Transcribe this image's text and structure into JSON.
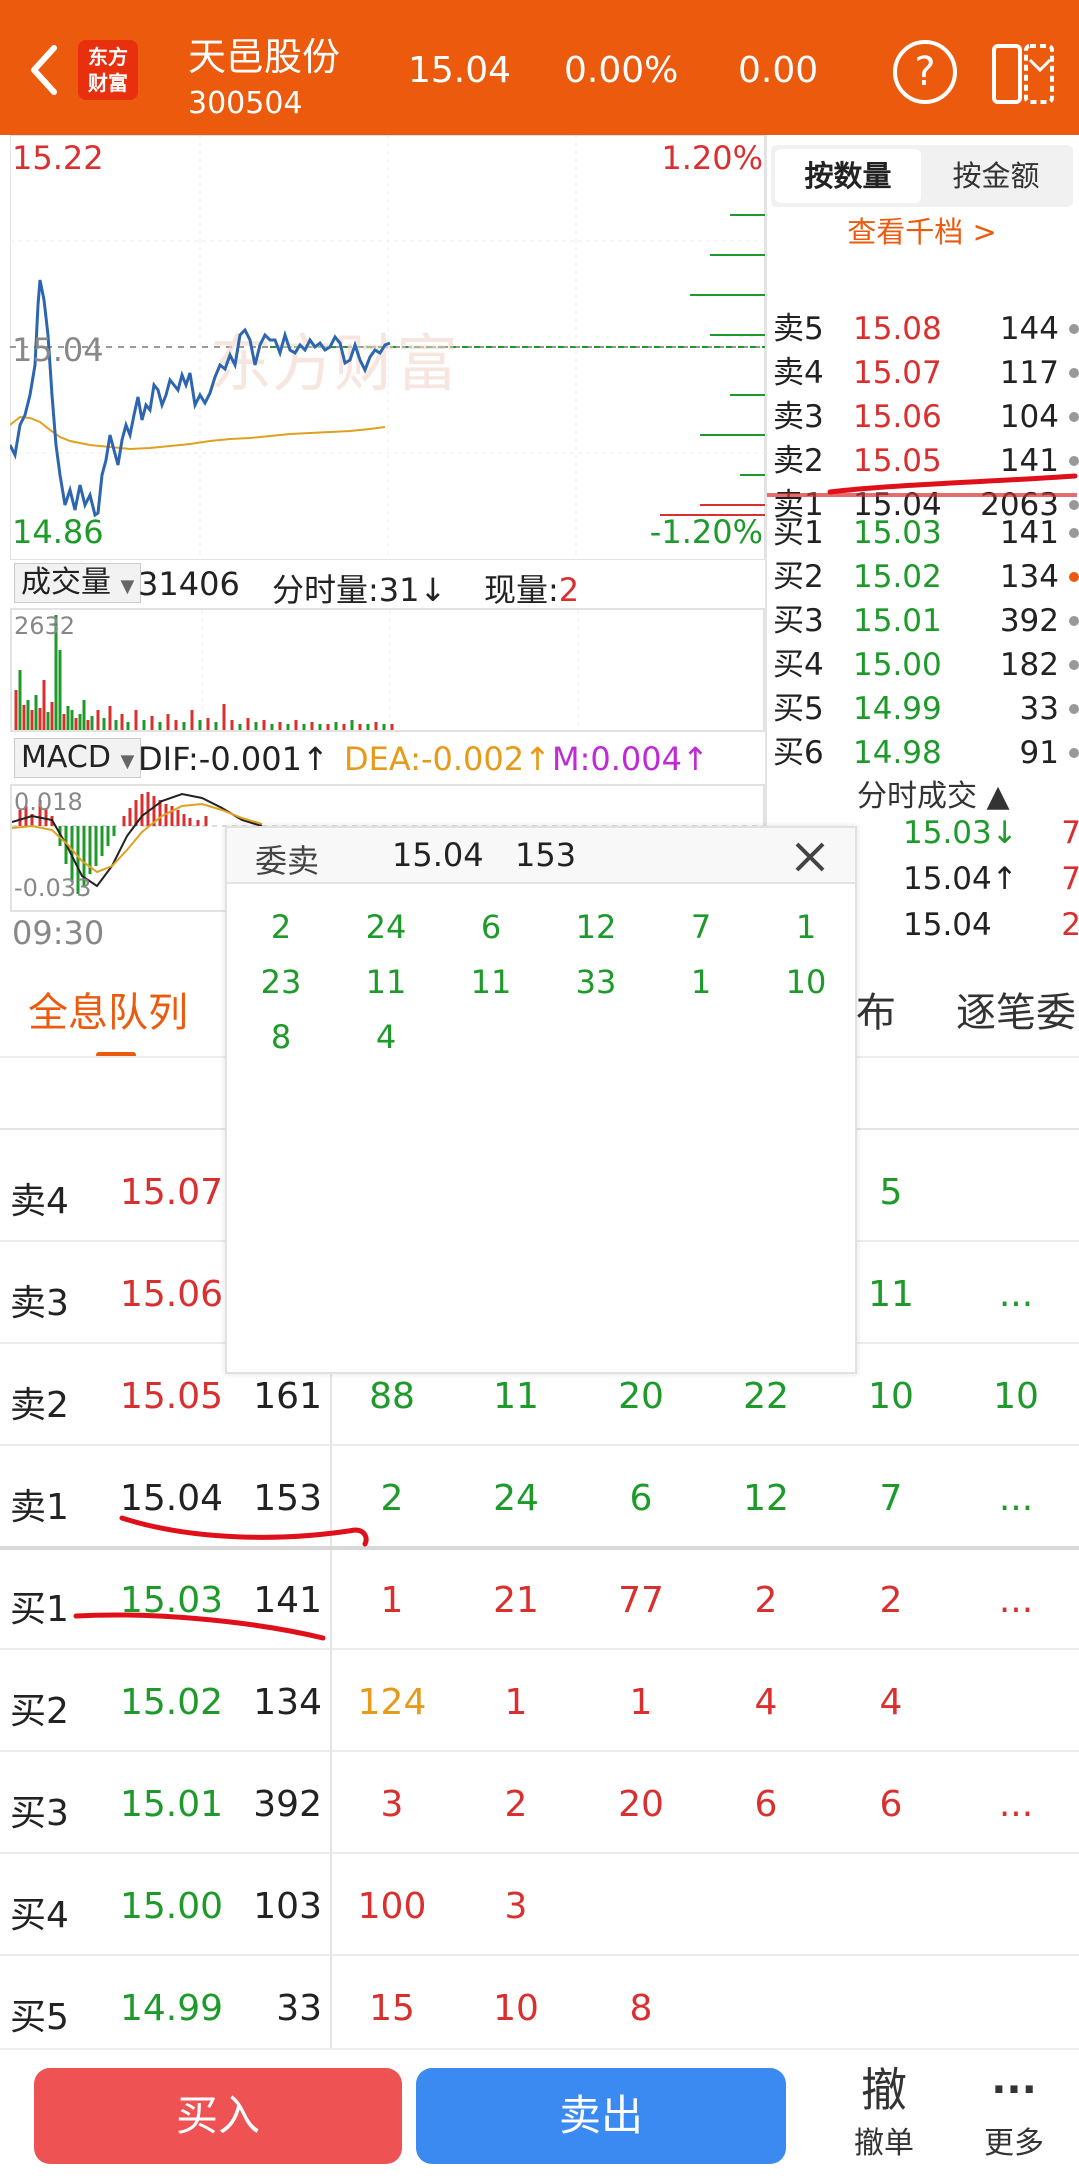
{
  "header": {
    "logo_text": "东方财富",
    "stock_name": "天邑股份",
    "stock_code": "300504",
    "price": "15.04",
    "change_pct": "0.00%",
    "change": "0.00",
    "help_glyph": "?"
  },
  "chart": {
    "price_high": "15.22",
    "price_mid": "15.04",
    "price_low": "14.86",
    "pct_high": "1.20%",
    "pct_low": "-1.20%",
    "watermark": "东方财富",
    "time_start": "09:30"
  },
  "volume": {
    "selector": "成交量",
    "total": "31406",
    "minute_label": "分时量:",
    "minute_value": "31",
    "current_label": "现量:",
    "current_value": "2",
    "max_label": "2632"
  },
  "macd": {
    "selector": "MACD",
    "dif": "DIF:-0.001",
    "dea": "DEA:-0.002",
    "m": "M:0.004",
    "top_label": "0.018",
    "bottom_label": "-0.033"
  },
  "order_book": {
    "tab_qty": "按数量",
    "tab_amount": "按金额",
    "view_more": "查看千档 >",
    "asks": [
      {
        "label": "卖5",
        "price": "15.08",
        "vol": "144"
      },
      {
        "label": "卖4",
        "price": "15.07",
        "vol": "117"
      },
      {
        "label": "卖3",
        "price": "15.06",
        "vol": "104"
      },
      {
        "label": "卖2",
        "price": "15.05",
        "vol": "141"
      },
      {
        "label": "卖1",
        "price": "15.04",
        "vol": "2063"
      }
    ],
    "bids": [
      {
        "label": "买1",
        "price": "15.03",
        "vol": "141"
      },
      {
        "label": "买2",
        "price": "15.02",
        "vol": "134"
      },
      {
        "label": "买3",
        "price": "15.01",
        "vol": "392"
      },
      {
        "label": "买4",
        "price": "15.00",
        "vol": "182"
      },
      {
        "label": "买5",
        "price": "14.99",
        "vol": "33"
      },
      {
        "label": "买6",
        "price": "14.98",
        "vol": "91"
      }
    ],
    "trades_title": "分时成交 ▲",
    "trades": [
      {
        "price": "15.03↓",
        "vol": "7"
      },
      {
        "price": "15.04↑",
        "vol": "7"
      },
      {
        "price": "15.04",
        "vol": "2"
      }
    ]
  },
  "sections": {
    "full_queue": "全息队列",
    "distribution": "布",
    "tick_orders": "逐笔委"
  },
  "queue": [
    {
      "label": "卖4",
      "price": "15.07",
      "vol": "",
      "c": [
        "",
        "",
        "",
        "",
        "5",
        ""
      ]
    },
    {
      "label": "卖3",
      "price": "15.06",
      "vol": "",
      "c": [
        "",
        "",
        "",
        "",
        "11",
        "..."
      ]
    },
    {
      "label": "卖2",
      "price": "15.05",
      "vol": "161",
      "c": [
        "88",
        "11",
        "20",
        "22",
        "10",
        "10"
      ]
    },
    {
      "label": "卖1",
      "price": "15.04",
      "vol": "153",
      "c": [
        "2",
        "24",
        "6",
        "12",
        "7",
        "..."
      ]
    },
    {
      "label": "买1",
      "price": "15.03",
      "vol": "141",
      "c": [
        "1",
        "21",
        "77",
        "2",
        "2",
        "..."
      ]
    },
    {
      "label": "买2",
      "price": "15.02",
      "vol": "134",
      "c": [
        "124",
        "1",
        "1",
        "4",
        "4",
        ""
      ]
    },
    {
      "label": "买3",
      "price": "15.01",
      "vol": "392",
      "c": [
        "3",
        "2",
        "20",
        "6",
        "6",
        "..."
      ]
    },
    {
      "label": "买4",
      "price": "15.00",
      "vol": "103",
      "c": [
        "100",
        "3",
        "",
        "",
        "",
        ""
      ]
    },
    {
      "label": "买5",
      "price": "14.99",
      "vol": "33",
      "c": [
        "15",
        "10",
        "8",
        "",
        "",
        ""
      ]
    }
  ],
  "popup": {
    "title": "委卖",
    "price": "15.04",
    "qty": "153",
    "cells": [
      "2",
      "24",
      "6",
      "12",
      "7",
      "1",
      "23",
      "11",
      "11",
      "33",
      "1",
      "10",
      "8",
      "4"
    ]
  },
  "bottom": {
    "buy": "买入",
    "sell": "卖出",
    "cancel_glyph": "撤",
    "cancel": "撤单",
    "more_glyph": "···",
    "more": "更多"
  }
}
